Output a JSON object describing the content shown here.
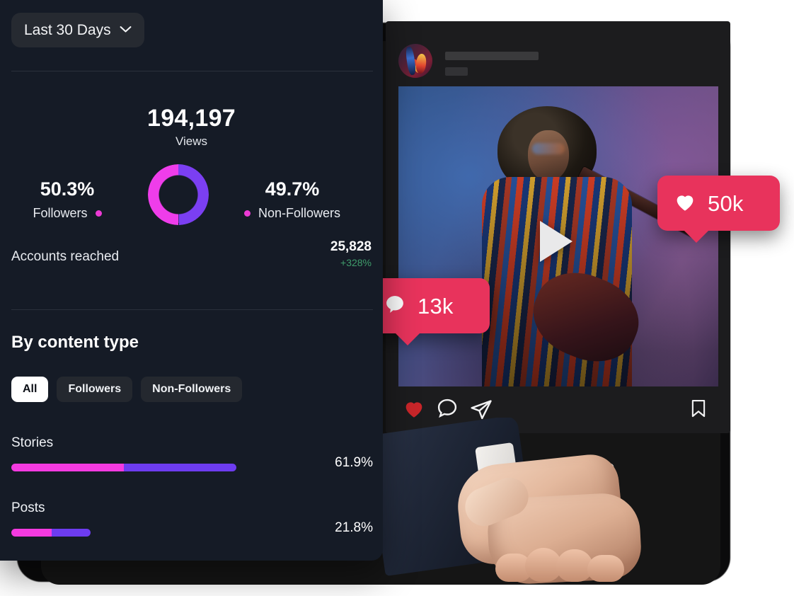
{
  "analytics": {
    "date_range": {
      "label": "Last 30 Days",
      "chevron_icon": "chevron-down-icon"
    },
    "views": {
      "value": "194,197",
      "label": "Views"
    },
    "audience_split": {
      "followers": {
        "percent": "50.3%",
        "label": "Followers"
      },
      "non_followers": {
        "percent": "49.7%",
        "label": "Non-Followers"
      }
    },
    "accounts_reached": {
      "label": "Accounts reached",
      "value": "25,828",
      "delta": "+328%"
    },
    "content_type": {
      "title": "By content type",
      "tabs": [
        {
          "label": "All",
          "active": true
        },
        {
          "label": "Followers",
          "active": false
        },
        {
          "label": "Non-Followers",
          "active": false
        }
      ],
      "rows": [
        {
          "name": "Stories",
          "percent": "61.9%"
        },
        {
          "name": "Posts",
          "percent": "21.8%"
        }
      ]
    }
  },
  "post": {
    "avatar_icon": "avatar",
    "media": {
      "play_icon": "play-icon"
    },
    "actions": {
      "like_icon": "heart-icon",
      "comment_icon": "comment-icon",
      "share_icon": "share-icon",
      "save_icon": "bookmark-icon"
    }
  },
  "engagement": {
    "likes": {
      "icon": "heart-icon",
      "count": "50k"
    },
    "comments": {
      "icon": "comment-icon",
      "count": "13k"
    }
  },
  "chart_data": {
    "type": "pie",
    "title": "Views by audience",
    "categories": [
      "Followers",
      "Non-Followers"
    ],
    "values": [
      50.3,
      49.7
    ],
    "colors": [
      "#ef3dea",
      "#7b3ff2"
    ],
    "total": 194197,
    "unit": "%",
    "legend": "sides",
    "secondary": {
      "type": "bar",
      "title": "By content type",
      "categories": [
        "Stories",
        "Posts"
      ],
      "values": [
        61.9,
        21.8
      ],
      "series": [
        {
          "name": "Followers",
          "values": [
            31.0,
            11.0
          ],
          "color": "#f43ae0"
        },
        {
          "name": "Non-Followers",
          "values": [
            30.9,
            10.8
          ],
          "color": "#6d3cf0"
        }
      ],
      "xlabel": "",
      "ylabel": "",
      "ylim": [
        0,
        100
      ],
      "grid": false,
      "orientation": "horizontal"
    }
  },
  "colors": {
    "panel_bg": "#151b26",
    "accent_magenta": "#ef3dea",
    "accent_purple": "#7b3ff2",
    "badge_pink": "#e8335c",
    "delta_green": "#3f9c6b"
  }
}
